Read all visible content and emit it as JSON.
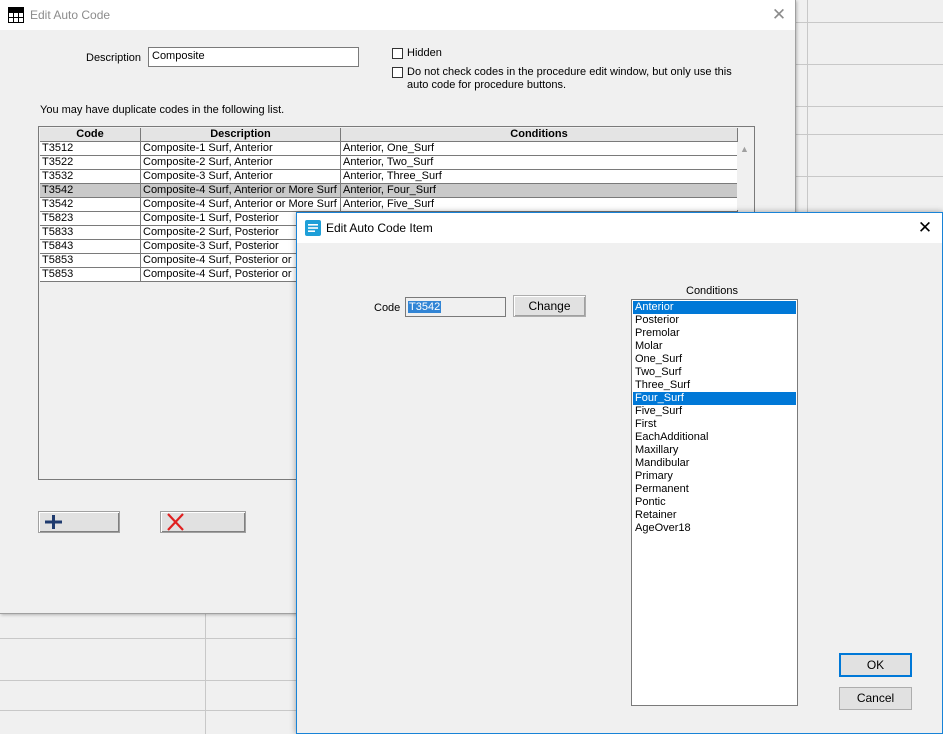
{
  "main_dialog": {
    "title": "Edit Auto Code",
    "close_glyph": "✕",
    "description_label": "Description",
    "description_value": "Composite",
    "hidden_label": "Hidden",
    "donotcheck_line1": "Do not check codes in the procedure edit window, but only use this",
    "donotcheck_line2": "auto code for procedure buttons.",
    "duplicate_note": "You may have duplicate codes  in the following list.",
    "columns": [
      "Code",
      "Description",
      "Conditions"
    ],
    "rows": [
      {
        "code": "T3512",
        "description": "Composite-1 Surf, Anterior",
        "conditions": "Anterior, One_Surf"
      },
      {
        "code": "T3522",
        "description": "Composite-2 Surf, Anterior",
        "conditions": "Anterior, Two_Surf"
      },
      {
        "code": "T3532",
        "description": "Composite-3 Surf, Anterior",
        "conditions": "Anterior, Three_Surf"
      },
      {
        "code": "T3542",
        "description": "Composite-4 Surf, Anterior or More Surf",
        "conditions": "Anterior, Four_Surf"
      },
      {
        "code": "T3542",
        "description": "Composite-4 Surf, Anterior or More Surf",
        "conditions": "Anterior, Five_Surf"
      },
      {
        "code": "T5823",
        "description": "Composite-1 Surf, Posterior",
        "conditions": ""
      },
      {
        "code": "T5833",
        "description": "Composite-2 Surf, Posterior",
        "conditions": ""
      },
      {
        "code": "T5843",
        "description": "Composite-3 Surf, Posterior",
        "conditions": ""
      },
      {
        "code": "T5853",
        "description": "Composite-4 Surf, Posterior or",
        "conditions": ""
      },
      {
        "code": "T5853",
        "description": "Composite-4 Surf, Posterior or",
        "conditions": ""
      }
    ],
    "selected_row": 3,
    "add_icon": "plus-icon",
    "delete_icon": "red-x-icon"
  },
  "item_dialog": {
    "title": "Edit Auto Code Item",
    "close_glyph": "✕",
    "code_label": "Code",
    "code_value": "T3542",
    "change_button": "Change",
    "conditions_label": "Conditions",
    "conditions": [
      "Anterior",
      "Posterior",
      "Premolar",
      "Molar",
      "One_Surf",
      "Two_Surf",
      "Three_Surf",
      "Four_Surf",
      "Five_Surf",
      "First",
      "EachAdditional",
      "Maxillary",
      "Mandibular",
      "Primary",
      "Permanent",
      "Pontic",
      "Retainer",
      "AgeOver18"
    ],
    "selected_conditions": [
      "Anterior",
      "Four_Surf"
    ],
    "ok_button": "OK",
    "cancel_button": "Cancel"
  },
  "colors": {
    "selection": "#0078d7",
    "grid_selected_row": "#c9c9c9",
    "delete_red": "#e02020",
    "add_blue": "#1f3a6e"
  }
}
